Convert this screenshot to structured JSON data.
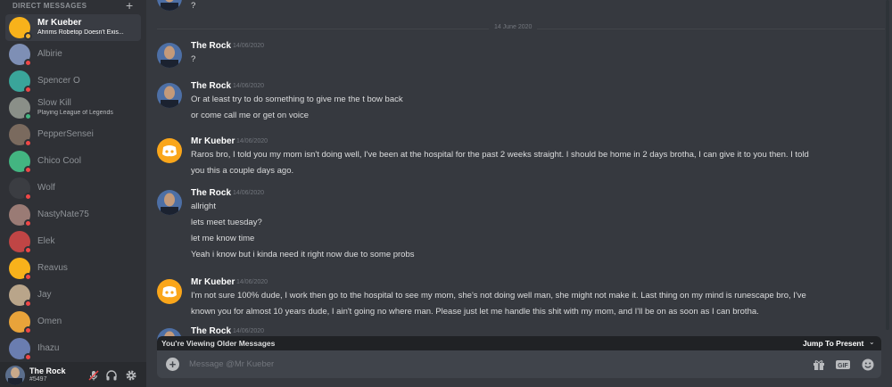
{
  "sidebar": {
    "header": "DIRECT MESSAGES",
    "add_icon": "plus-icon",
    "items": [
      {
        "name": "Mr Kueber",
        "sub": "Ahrims Robetop Doesn't Exis...",
        "active": true,
        "color": "#f8b21b",
        "status": "#f0b232"
      },
      {
        "name": "Albirie",
        "sub": "",
        "color": "#7e8fb5",
        "status": "#f04747"
      },
      {
        "name": "Spencer O",
        "sub": "",
        "color": "#3aa59a",
        "status": "#f04747"
      },
      {
        "name": "Slow Kill",
        "sub": "Playing League of Legends",
        "color": "#8a8f88",
        "status": "#43b581"
      },
      {
        "name": "PepperSensei",
        "sub": "",
        "color": "#7a6a5e",
        "status": "#f04747"
      },
      {
        "name": "Chico Cool",
        "sub": "",
        "color": "#43b581",
        "status": "#f04747"
      },
      {
        "name": "Wolf",
        "sub": "",
        "color": "#3b3d42",
        "status": "#f04747"
      },
      {
        "name": "NastyNate75",
        "sub": "",
        "color": "#9a7b75",
        "status": "#f04747"
      },
      {
        "name": "Elek",
        "sub": "",
        "color": "#c04545",
        "status": "#f04747"
      },
      {
        "name": "Reavus",
        "sub": "",
        "color": "#f8b21b",
        "status": "#f04747"
      },
      {
        "name": "Jay",
        "sub": "",
        "color": "#b9a58a",
        "status": "#f04747"
      },
      {
        "name": "Omen",
        "sub": "",
        "color": "#e8a33a",
        "status": "#f04747"
      },
      {
        "name": "Ihazu",
        "sub": "",
        "color": "#6a7db0",
        "status": "#f04747"
      }
    ],
    "user": {
      "name": "The Rock",
      "tag": "#5497"
    }
  },
  "chat": {
    "top_partial": "?",
    "date_divider": "14 June 2020",
    "messages": [
      {
        "author": "The Rock",
        "time": "14/06/2020",
        "avatar": "rock",
        "lines": [
          "?"
        ]
      },
      {
        "author": "The Rock",
        "time": "14/06/2020",
        "avatar": "rock",
        "lines": [
          "Or at least try to do something to give me the t bow back",
          "or come call me or get on voice"
        ]
      },
      {
        "author": "Mr Kueber",
        "time": "14/06/2020",
        "avatar": "discord",
        "lines": [
          "Raros bro, I told you my mom isn't doing well, I've been at the hospital for the past 2 weeks straight. I should be home in 2 days brotha, I can give it to you then. I told",
          "you this a couple days ago."
        ]
      },
      {
        "author": "The Rock",
        "time": "14/06/2020",
        "avatar": "rock",
        "lines": [
          "allright",
          "lets meet tuesday?",
          "let me know time",
          "Yeah i know but i kinda need it right now due to some probs"
        ]
      },
      {
        "author": "Mr Kueber",
        "time": "14/06/2020",
        "avatar": "discord",
        "lines": [
          "I'm not sure 100% dude, I work then go to the hospital to see my mom, she's not doing well man, she might not make it. Last thing on my mind is runescape bro, I've",
          "known you for almost 10 years dude, I ain't going no where man. Please just let me handle this shit with my mom, and I'll be on as soon as I can brotha."
        ]
      },
      {
        "author": "The Rock",
        "time": "14/06/2020",
        "avatar": "rock",
        "lines": []
      }
    ],
    "older_notice": "You're Viewing Older Messages",
    "jump_label": "Jump To Present",
    "composer_placeholder": "Message @Mr Kueber"
  },
  "colors": {
    "background": "#36393f",
    "sidebar": "#2f3136",
    "blurple": "#7289da",
    "online": "#43b581",
    "dnd": "#f04747"
  }
}
